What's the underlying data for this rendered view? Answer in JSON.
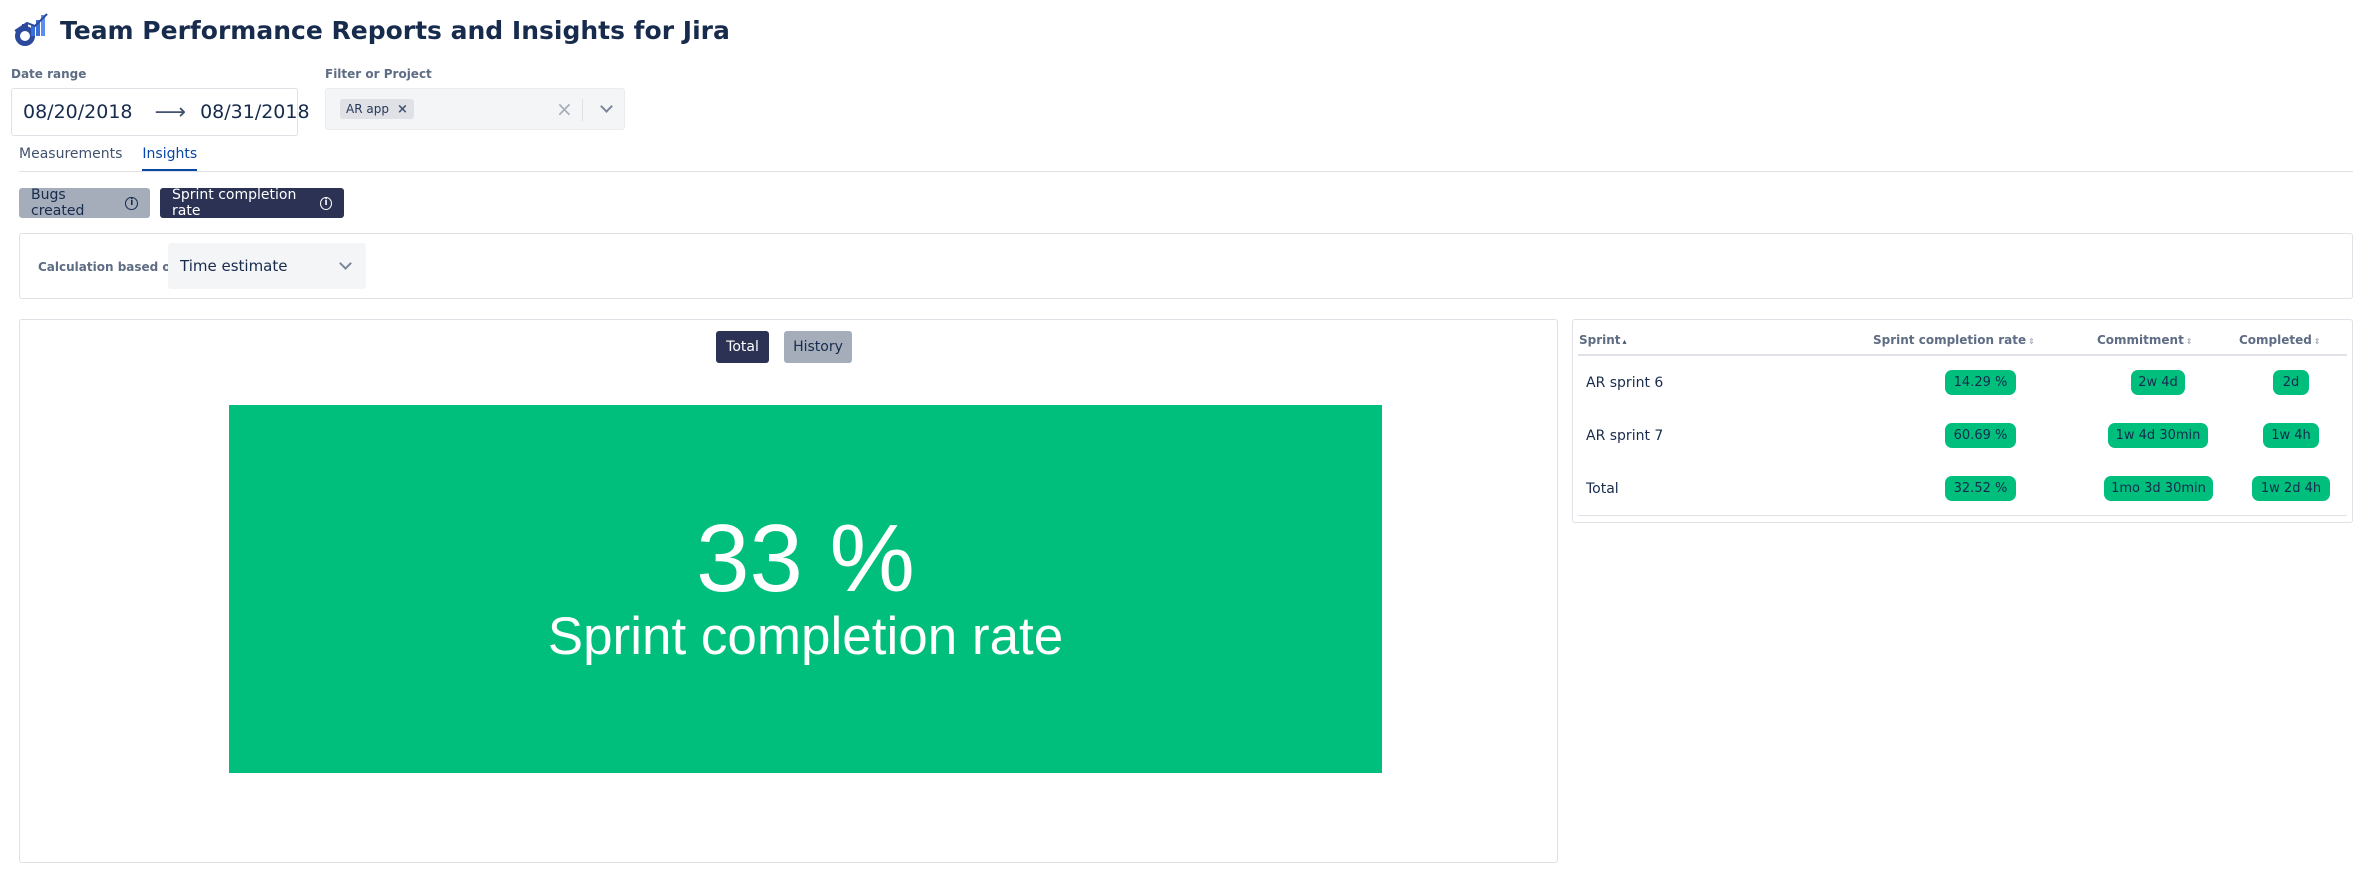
{
  "app": {
    "title": "Team Performance Reports and Insights for Jira"
  },
  "filters": {
    "date_range_label": "Date range",
    "date_from": "08/20/2018",
    "date_arrow": "⟶",
    "date_to": "08/31/2018",
    "project_label": "Filter or Project",
    "project_chip": "AR app",
    "chip_remove": "×",
    "clear": "×"
  },
  "tabs": [
    {
      "label": "Measurements",
      "active": false
    },
    {
      "label": "Insights",
      "active": true
    }
  ],
  "insights": {
    "bugs_created": "Bugs created",
    "sprint_completion_rate": "Sprint completion rate",
    "info_glyph": "i"
  },
  "calculation": {
    "label": "Calculation based on:",
    "value": "Time estimate"
  },
  "chart": {
    "total_label": "Total",
    "history_label": "History",
    "big_value": "33 %",
    "big_label": "Sprint completion rate",
    "card_color": "#00bf7d"
  },
  "table": {
    "headers": {
      "sprint": "Sprint",
      "rate": "Sprint completion rate",
      "commitment": "Commitment",
      "completed": "Completed"
    },
    "rows": [
      {
        "sprint": "AR sprint 6",
        "rate": "14.29 %",
        "commitment": "2w 4d",
        "completed": "2d"
      },
      {
        "sprint": "AR sprint 7",
        "rate": "60.69 %",
        "commitment": "1w 4d 30min",
        "completed": "1w 4h"
      },
      {
        "sprint": "Total",
        "rate": "32.52 %",
        "commitment": "1mo 3d 30min",
        "completed": "1w 2d 4h"
      }
    ]
  },
  "icons": {
    "logo": "performance-logo-icon",
    "chevron": "chevron-down-icon",
    "info": "info-icon",
    "sort": "sort-icon"
  }
}
